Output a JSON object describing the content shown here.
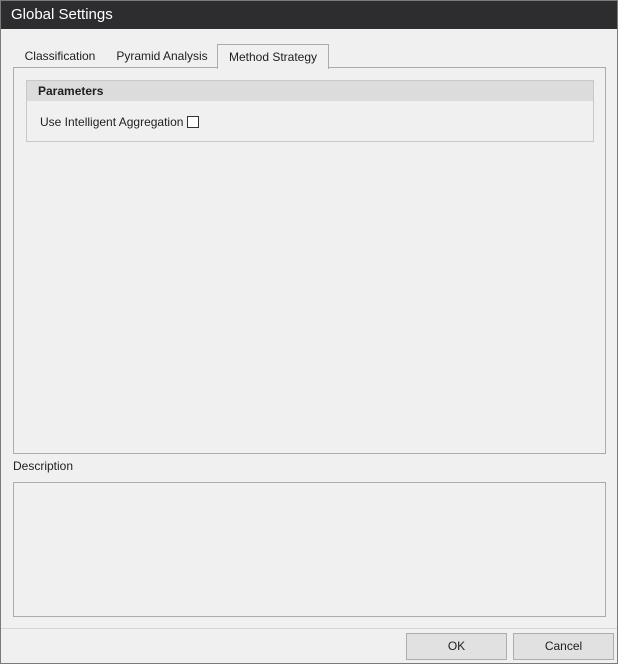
{
  "window": {
    "title": "Global Settings"
  },
  "tabs": [
    {
      "label": "Classification",
      "selected": false
    },
    {
      "label": "Pyramid Analysis",
      "selected": false
    },
    {
      "label": "Method Strategy",
      "selected": true
    }
  ],
  "parameters": {
    "header": "Parameters",
    "use_intelligent_aggregation": {
      "label": "Use Intelligent Aggregation",
      "checked": false
    }
  },
  "description": {
    "label": "Description",
    "text": ""
  },
  "buttons": {
    "ok": "OK",
    "cancel": "Cancel"
  },
  "colors": {
    "titlebar": "#2d2d30",
    "background": "#f0f0f0",
    "group_header": "#dcdcdc"
  }
}
